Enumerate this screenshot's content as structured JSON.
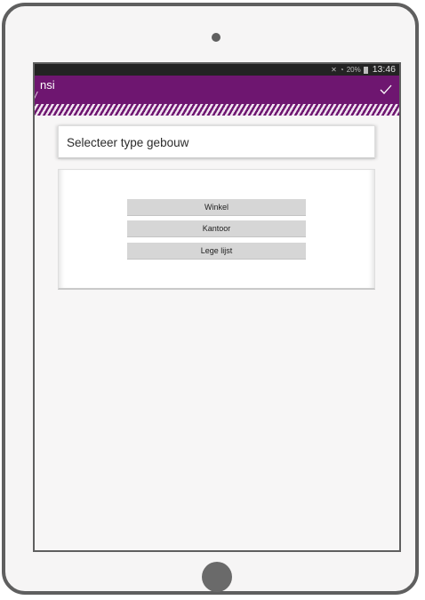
{
  "status_bar": {
    "signal_icons": "icons",
    "battery_percent": "20%",
    "time": "13:46"
  },
  "action_bar": {
    "title": "nsi",
    "confirm_icon": "checkmark-icon",
    "background_color": "#6e1670"
  },
  "card": {
    "title": "Selecteer type gebouw"
  },
  "options": [
    {
      "label": "Winkel"
    },
    {
      "label": "Kantoor"
    },
    {
      "label": "Lege lijst"
    }
  ]
}
